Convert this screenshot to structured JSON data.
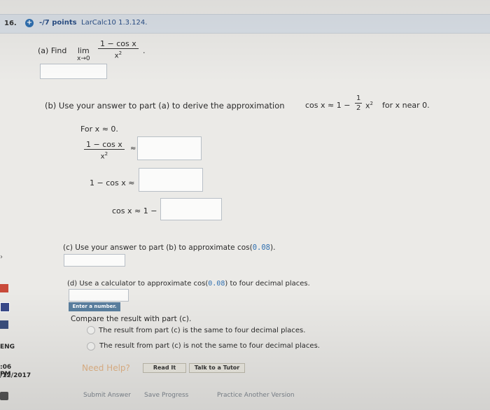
{
  "header": {
    "question_number": "16.",
    "points": "-/7 points",
    "course": "LarCalc10 1.3.124."
  },
  "part_a": {
    "label": "(a) Find",
    "lim": "lim",
    "lim_sub": "x→0",
    "numerator": "1 − cos x",
    "denominator": "x",
    "den_exp": "2",
    "period": "."
  },
  "part_b": {
    "label": "(b) Use your answer to part (a) to derive the approximation",
    "approx_lhs": "cos x ≈ 1 −",
    "half_num": "1",
    "half_den": "2",
    "approx_tail": "x",
    "approx_exp": "2",
    "approx_suffix": "for x near 0.",
    "for_line": "For  x ≈ 0.",
    "frac_num": "1 − cos x",
    "frac_den": "x",
    "frac_den_exp": "2",
    "approx_symbol": "≈",
    "line2": "1 − cos x ≈",
    "line3": "cos x ≈ 1 −"
  },
  "part_c": {
    "label_pre": "(c) Use your answer to part (b) to approximate  cos(",
    "value": "0.08",
    "label_post": ")."
  },
  "part_d": {
    "label_pre": "(d) Use a calculator to approximate  cos(",
    "value": "0.08",
    "label_post": ")  to four decimal places.",
    "enter_button": "Enter a number.",
    "compare": "Compare the result with part (c).",
    "option1": "The result from part (c) is the same to four decimal places.",
    "option2": "The result from part (c) is not the same to four decimal places."
  },
  "help": {
    "need_help": "Need Help?",
    "read_it": "Read It",
    "talk_tutor": "Talk to a Tutor"
  },
  "footer": {
    "submit": "Submit Answer",
    "save": "Save Progress",
    "practice": "Practice Another Version"
  },
  "taskbar": {
    "lang": "ENG",
    "time": ":06 PM",
    "date": "/12/2017"
  },
  "colors": {
    "header_bg": "#d9dfe6",
    "link_blue": "#2a4e86",
    "highlight_value": "#2f6fb0"
  }
}
